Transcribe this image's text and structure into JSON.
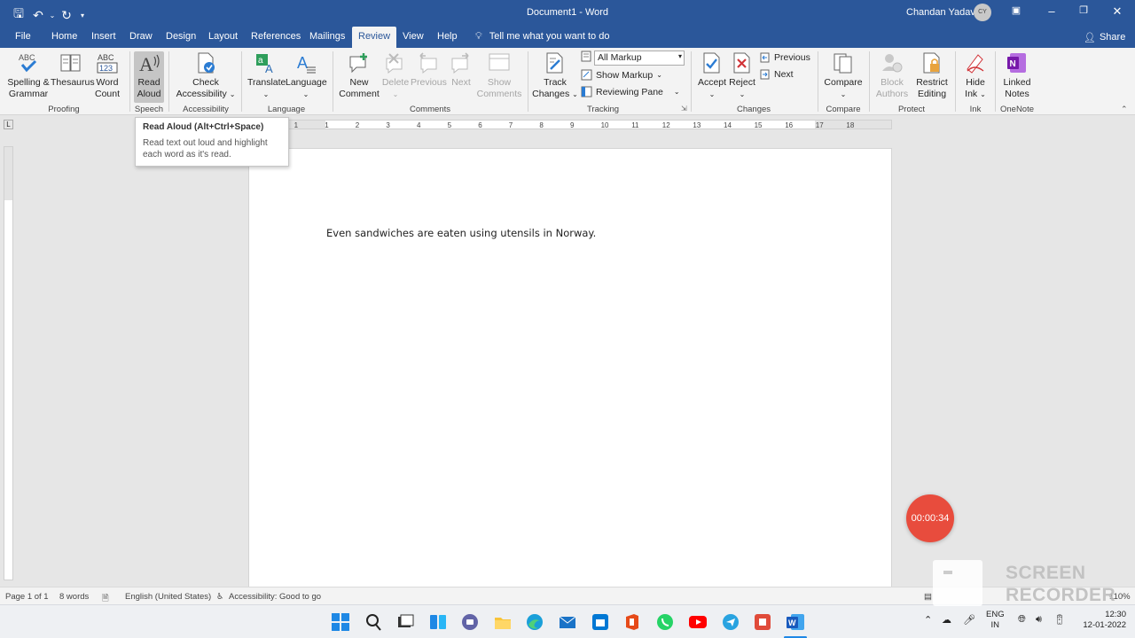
{
  "titlebar": {
    "doc_title": "Document1 - Word",
    "user_name": "Chandan Yadav",
    "user_initials": "CY"
  },
  "tabs": [
    "File",
    "Home",
    "Insert",
    "Draw",
    "Design",
    "Layout",
    "References",
    "Mailings",
    "Review",
    "View",
    "Help"
  ],
  "active_tab": "Review",
  "tell_me": "Tell me what you want to do",
  "share": "Share",
  "ribbon": {
    "proofing": {
      "spelling": "Spelling &",
      "spelling2": "Grammar",
      "thesaurus": "Thesaurus",
      "word_count": "Word",
      "word_count2": "Count",
      "label": "Proofing"
    },
    "speech": {
      "read": "Read",
      "read2": "Aloud",
      "label": "Speech"
    },
    "accessibility": {
      "check": "Check",
      "check2": "Accessibility",
      "label": "Accessibility"
    },
    "language": {
      "translate": "Translate",
      "language": "Language",
      "label": "Language"
    },
    "comments": {
      "new": "New",
      "new2": "Comment",
      "delete": "Delete",
      "previous": "Previous",
      "next": "Next",
      "show": "Show",
      "show2": "Comments",
      "label": "Comments"
    },
    "tracking": {
      "track": "Track",
      "track2": "Changes",
      "markup_value": "All Markup",
      "show_markup": "Show Markup",
      "reviewing_pane": "Reviewing Pane",
      "label": "Tracking"
    },
    "changes": {
      "accept": "Accept",
      "reject": "Reject",
      "previous": "Previous",
      "next": "Next",
      "label": "Changes"
    },
    "compare": {
      "compare": "Compare",
      "label": "Compare"
    },
    "protect": {
      "block": "Block",
      "block2": "Authors",
      "restrict": "Restrict",
      "restrict2": "Editing",
      "label": "Protect"
    },
    "ink": {
      "hide": "Hide",
      "hide2": "Ink",
      "label": "Ink"
    },
    "onenote": {
      "linked": "Linked",
      "linked2": "Notes",
      "label": "OneNote"
    }
  },
  "tooltip": {
    "title": "Read Aloud (Alt+Ctrl+Space)",
    "desc": "Read text out loud and highlight each word as it's read."
  },
  "document": {
    "text": "Even sandwiches are eaten using utensils in Norway."
  },
  "ruler_numbers": [
    "2",
    "1",
    "1",
    "2",
    "3",
    "4",
    "5",
    "6",
    "7",
    "8",
    "9",
    "10",
    "11",
    "12",
    "13",
    "14",
    "15",
    "16",
    "17",
    "18"
  ],
  "statusbar": {
    "page": "Page 1 of 1",
    "words": "8 words",
    "language": "English (United States)",
    "accessibility": "Accessibility: Good to go",
    "zoom": "110%"
  },
  "taskbar": {
    "lang1": "ENG",
    "lang2": "IN",
    "time": "12:30",
    "date": "12-01-2022"
  },
  "recorder": {
    "timer": "00:00:34",
    "brand1": "SCREEN",
    "brand2": "RECORDER"
  },
  "colors": {
    "word_blue": "#2b579a",
    "ribbon_bg": "#f3f3f3",
    "recorder_red": "#e84c3d"
  }
}
